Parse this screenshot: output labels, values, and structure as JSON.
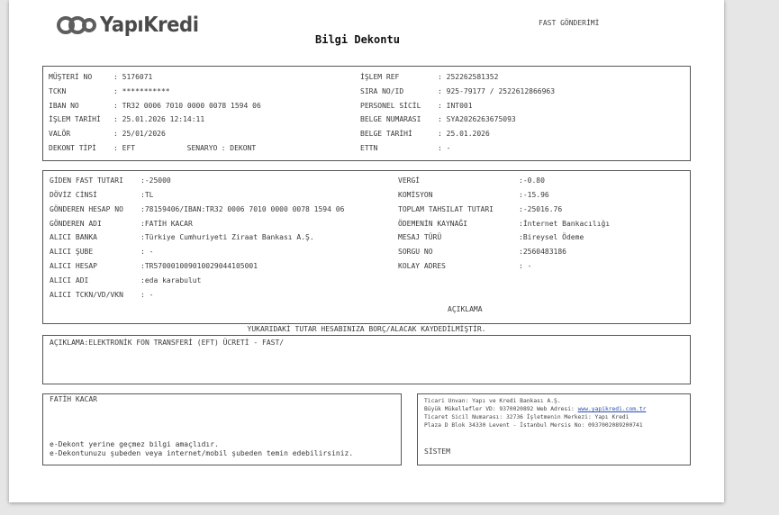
{
  "header": {
    "bank_name": "YapıKredi",
    "title": "Bilgi Dekontu",
    "fast_label": "FAST GÖNDERİMİ"
  },
  "customer": {
    "musteri_no_label": "MÜŞTERİ NO",
    "musteri_no": "5176071",
    "tckn_label": "TCKN",
    "tckn": "***********",
    "iban_label": "IBAN NO",
    "iban": "TR32 0006 7010 0000 0078 1594 06",
    "islem_tarihi_label": "İŞLEM TARİHİ",
    "islem_tarihi": "25.01.2026 12:14:11",
    "valor_label": "VALÖR",
    "valor": "25/01/2026",
    "dekont_tipi_label": "DEKONT TİPİ",
    "dekont_tipi": "EFT",
    "senaryo_label": "SENARYO",
    "senaryo": "DEKONT",
    "islem_ref_label": "İŞLEM REF",
    "islem_ref": "252262581352",
    "sira_no_label": "SIRA NO/ID",
    "sira_no": "925-79177 / 2522612866963",
    "personel_label": "PERSONEL SİCİL",
    "personel": "INT001",
    "belge_no_label": "BELGE NUMARASI",
    "belge_no": "SYA2026263675093",
    "belge_tarihi_label": "BELGE TARİHİ",
    "belge_tarihi": "25.01.2026",
    "ettn_label": "ETTN",
    "ettn": "-"
  },
  "transfer": {
    "giden_tutar_label": "GİDEN FAST TUTARI",
    "giden_tutar": "-25000",
    "doviz_label": "DÖVİZ CİNSİ",
    "doviz": "TL",
    "gonderen_hesap_label": "GÖNDEREN HESAP NO",
    "gonderen_hesap": "78159406/IBAN:TR32 0006 7010 0000 0078 1594 06",
    "gonderen_adi_label": "GÖNDEREN ADI",
    "gonderen_adi": "FATİH KACAR",
    "alici_banka_label": "ALICI BANKA",
    "alici_banka": "Türkiye Cumhuriyeti Ziraat Bankası A.Ş.",
    "alici_sube_label": "ALICI ŞUBE",
    "alici_sube": "-",
    "alici_hesap_label": "ALICI HESAP",
    "alici_hesap": "TR570001009010029044105001",
    "alici_adi_label": "ALICI ADI",
    "alici_adi": "eda karabulut",
    "alici_tckn_label": "ALICI TCKN/VD/VKN",
    "alici_tckn": "-",
    "vergi_label": "VERGİ",
    "vergi": "-0.80",
    "komisyon_label": "KOMİSYON",
    "komisyon": "-15.96",
    "toplam_label": "TOPLAM TAHSILAT TUTARI",
    "toplam": "-25016.76",
    "odeme_kaynagi_label": "ÖDEMENİN KAYNAĞI",
    "odeme_kaynagi": "İnternet Bankacılığı",
    "mesaj_turu_label": "MESAJ TÜRÜ",
    "mesaj_turu": "Bireysel Ödeme",
    "sorgu_no_label": "SORGU NO",
    "sorgu_no": "2560483186",
    "kolay_adres_label": "KOLAY ADRES",
    "kolay_adres": "-",
    "aciklama_heading": "AÇIKLAMA"
  },
  "notice": "YUKARIDAKİ TUTAR HESABINIZA BORÇ/ALACAK KAYDEDİLMİŞTİR.",
  "description": "AÇIKLAMA:ELEKTRONİK FON TRANSFERİ (EFT) ÜCRETİ - FAST/",
  "footer_left": {
    "name": "FATİH KACAR",
    "note1": "e-Dekont yerine geçmez bilgi amaçlıdır.",
    "note2": "e-Dekontunuzu şubeden veya internet/mobil şubeden temin edebilirsiniz."
  },
  "footer_right": {
    "line1": "Ticari Unvan: Yapı ve Kredi Bankası A.Ş.",
    "line2_prefix": "Büyük Mükellefler VD: 9370020892 Web Adresi: ",
    "link": "www.yapikredi.com.tr",
    "line3": "Ticaret Sicil Numarası: 32736 İşletmenin Merkezi: Yapı Kredi",
    "line4": "Plaza D Blok 34330 Levent - İstanbul Mersis No: 0937002089200741",
    "system": "SİSTEM"
  },
  "colors": {
    "logo_blue": "#5b6770",
    "link": "#2a4fb5",
    "border": "#555555"
  }
}
